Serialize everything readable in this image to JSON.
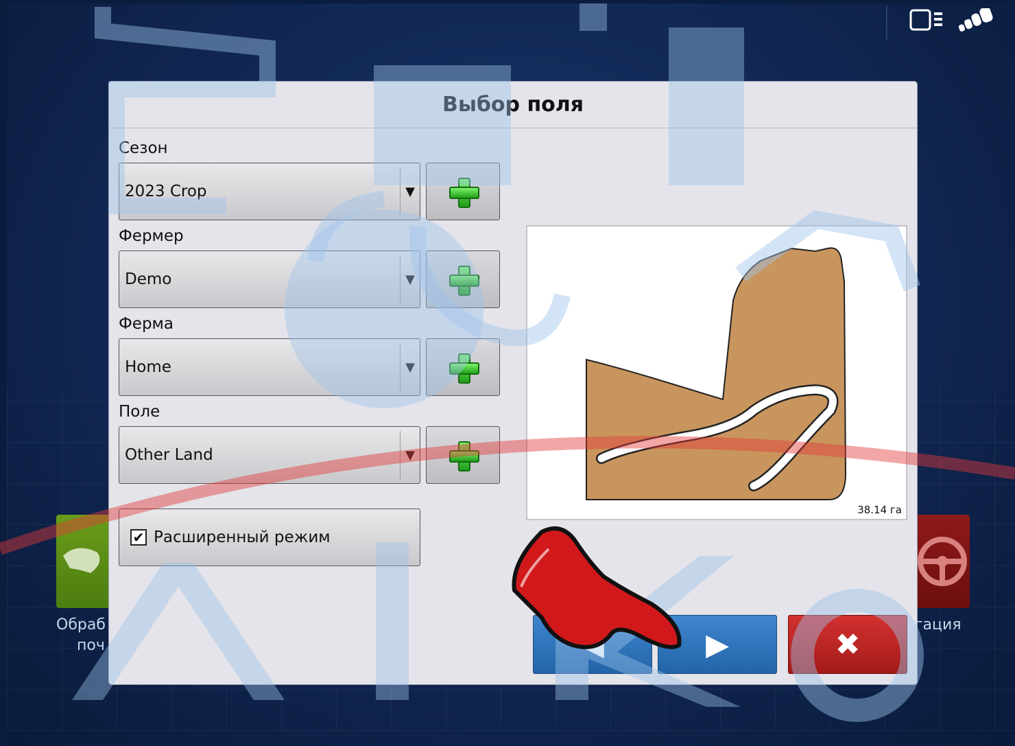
{
  "dialog": {
    "title": "Выбор поля",
    "season": {
      "label": "Сезон",
      "value": "2023 Crop"
    },
    "farmer": {
      "label": "Фермер",
      "value": "Demo"
    },
    "farm": {
      "label": "Ферма",
      "value": "Home"
    },
    "field": {
      "label": "Поле",
      "value": "Other Land"
    },
    "advanced_mode": {
      "label": "Расширенный режим",
      "checked": true
    },
    "map_preview": {
      "area_text": "38.14 га"
    },
    "buttons": {
      "back": "◀",
      "next": "▶",
      "cancel": "✖"
    }
  },
  "background": {
    "left_tile_label_line1": "Обраб",
    "left_tile_label_line2": "поч",
    "right_tile_label": "гация"
  },
  "status_bar": {
    "icons": [
      "display-mode-icon",
      "gps-signal-icon"
    ]
  },
  "colors": {
    "accent_blue": "#2f74c0",
    "cancel_red": "#c0262a",
    "plus_green": "#3cc22e",
    "field_brown": "#c8955e"
  }
}
